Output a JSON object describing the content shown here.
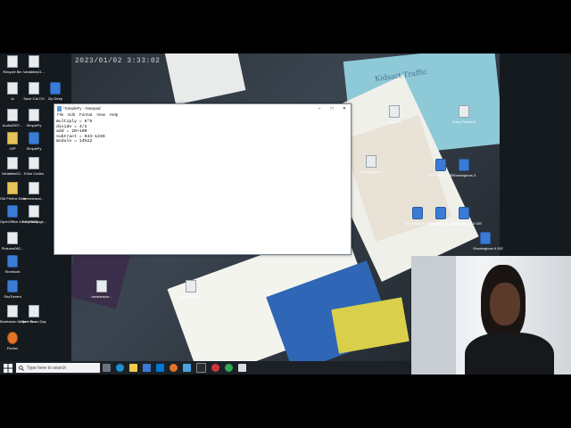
{
  "wallpaper": {
    "timestamp": "2023/01/02 3:33:02",
    "book_title": "Kidsart Traffic"
  },
  "desktop_icons_left": [
    {
      "label": "Recycle Bin",
      "kind": "file"
    },
    {
      "label": "Variables01...",
      "kind": "file"
    },
    {
      "label": "1c",
      "kind": "file"
    },
    {
      "label": "Save Cat CH",
      "kind": "file"
    },
    {
      "label": "Zip Deep",
      "kind": "app"
    },
    {
      "label": "Audio0307...",
      "kind": "file"
    },
    {
      "label": "SimpleFy",
      "kind": "file"
    },
    {
      "label": "JVP",
      "kind": "folder"
    },
    {
      "label": "SimpleFy",
      "kind": "app"
    },
    {
      "label": "Variables02...",
      "kind": "file"
    },
    {
      "label": "Echo Codes",
      "kind": "file"
    },
    {
      "label": "Old Firefox Data",
      "kind": "folder"
    },
    {
      "label": "Icemanson...",
      "kind": "file"
    },
    {
      "label": "OpenOffice 4.1.7 (en-U)...",
      "kind": "app"
    },
    {
      "label": "Hack Settings...",
      "kind": "file"
    },
    {
      "label": "Pictures062...",
      "kind": "file"
    },
    {
      "label": "Shortcuts",
      "kind": "app"
    },
    {
      "label": "ShoTorrent",
      "kind": "app"
    },
    {
      "label": "Bombardo Ninja + Gr...",
      "kind": "file"
    },
    {
      "label": "New Years Day",
      "kind": "file"
    },
    {
      "label": "Firefox",
      "kind": "fox"
    }
  ],
  "desktop_icons_wallpaper": [
    {
      "label": "Icemanson...",
      "kind": "file"
    },
    {
      "label": "Easy Pocket 4",
      "kind": "file"
    },
    {
      "label": "SimpleFy",
      "kind": "file"
    },
    {
      "label": "Easy Pocket 6",
      "kind": "file"
    },
    {
      "label": "Showingtons 1",
      "kind": "file"
    },
    {
      "label": "Air Force 2 IDE",
      "kind": "app"
    },
    {
      "label": "Showingtons 3",
      "kind": "app"
    },
    {
      "label": "Showingtons 2 IDE",
      "kind": "app"
    },
    {
      "label": "Showingtons 4 IDE",
      "kind": "app"
    },
    {
      "label": "Showingtons 5 IDE",
      "kind": "app"
    },
    {
      "label": "Showingtons 6 IDE",
      "kind": "app"
    }
  ],
  "notepad": {
    "title": "*SimpleFy - Notepad",
    "menu": [
      "File",
      "Edit",
      "Format",
      "View",
      "Help"
    ],
    "lines": [
      "multiply = 6*5",
      "divide = 4/2",
      "add = 20+100",
      "subtract = 943-1236",
      "modulo = 14%12"
    ],
    "minimize": "–",
    "maximize": "□",
    "close": "✕"
  },
  "taskbar": {
    "search_placeholder": "Type here to search"
  },
  "colors": {
    "taskbar": "#1c2128",
    "notepad_bg": "#ffffff",
    "accent": "#3a7bd5"
  }
}
